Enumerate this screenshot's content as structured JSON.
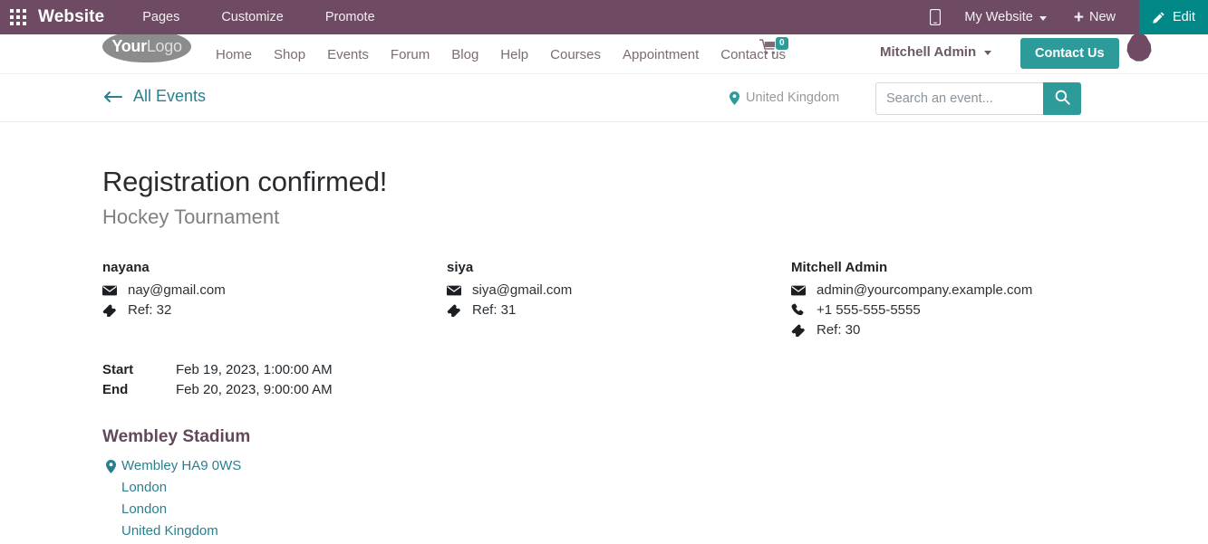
{
  "colors": {
    "odoo_purple": "#6E4B63",
    "teal": "#2E9B9B",
    "edit_teal": "#018786",
    "link_teal": "#2A7F8F",
    "venue_purple": "#63485C"
  },
  "odoo_bar": {
    "apps_icon": "apps-grid-icon",
    "app_name": "Website",
    "menus": [
      "Pages",
      "Customize",
      "Promote"
    ],
    "mobile_icon": "mobile-preview-icon",
    "website_selector": "My Website",
    "new_label": "New",
    "new_icon": "plus-icon",
    "edit_label": "Edit",
    "edit_icon": "pencil-icon"
  },
  "site_header": {
    "logo_bold": "Your",
    "logo_light": "Logo",
    "nav": [
      "Home",
      "Shop",
      "Events",
      "Forum",
      "Blog",
      "Help",
      "Courses",
      "Appointment",
      "Contact us"
    ],
    "cart_icon": "shopping-cart-icon",
    "cart_count": "0",
    "user_name": "Mitchell Admin",
    "contact_us": "Contact Us"
  },
  "events_bar": {
    "back_icon": "arrow-left-icon",
    "all_events": "All Events",
    "location_icon": "map-pin-icon",
    "location": "United Kingdom",
    "search_placeholder": "Search an event...",
    "search_value": "",
    "search_icon": "search-icon"
  },
  "main": {
    "title": "Registration confirmed!",
    "subtitle": "Hockey Tournament",
    "attendees": [
      {
        "name": "nayana",
        "email": "nay@gmail.com",
        "phone": "",
        "ref": "Ref: 32"
      },
      {
        "name": "siya",
        "email": "siya@gmail.com",
        "phone": "",
        "ref": "Ref: 31"
      },
      {
        "name": "Mitchell Admin",
        "email": "admin@yourcompany.example.com",
        "phone": "+1 555-555-5555",
        "ref": "Ref: 30"
      }
    ],
    "schedule": {
      "start_label": "Start",
      "start_value": "Feb 19, 2023, 1:00:00 AM",
      "end_label": "End",
      "end_value": "Feb 20, 2023, 9:00:00 AM"
    },
    "venue": {
      "name": "Wembley Stadium",
      "street": "Wembley HA9 0WS",
      "city": "London",
      "state": "London",
      "country": "United Kingdom"
    }
  }
}
